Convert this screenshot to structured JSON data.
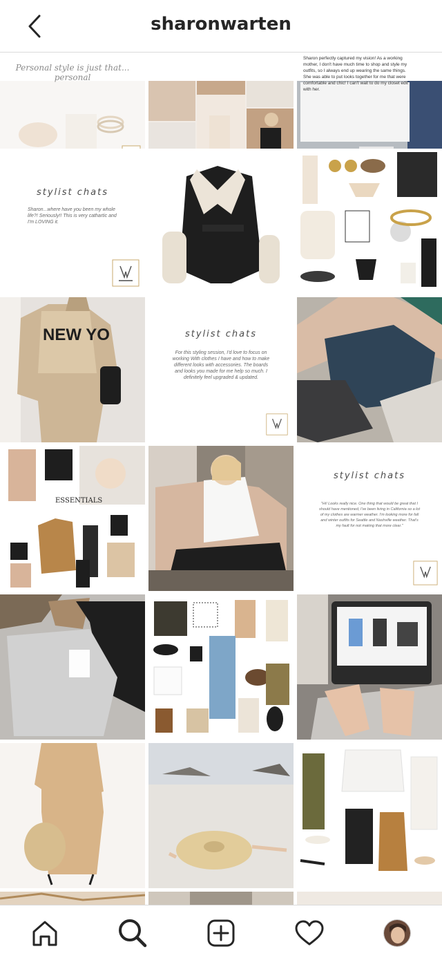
{
  "header": {
    "title": "sharonwarten",
    "back_icon": "chevron-left-icon"
  },
  "posts": [
    {
      "id": "post-1",
      "kind": "quote-image",
      "text": "Personal style is just that... personal"
    },
    {
      "id": "post-2",
      "kind": "photo-collage"
    },
    {
      "id": "post-3",
      "kind": "photo-text",
      "text": "Sharon perfectly captured my vision! As a working mother, I don't have much time to shop and style my outfits, so I always end up wearing the same things. She was able to put looks together for me that were comfortable and chic! I can't wait to do my closet edit with her."
    },
    {
      "id": "post-4",
      "kind": "quote",
      "title": "stylist chats",
      "text": "Sharon...where have you been my whole life?! Seriously!! This is very cathartic and I'm LOVING it."
    },
    {
      "id": "post-5",
      "kind": "photo"
    },
    {
      "id": "post-6",
      "kind": "photo"
    },
    {
      "id": "post-7",
      "kind": "photo",
      "text": "NEW YO"
    },
    {
      "id": "post-8",
      "kind": "quote",
      "title": "stylist chats",
      "text": "For this styling session, I'd love to focus on working With clothes I have and how to make different looks with accessories. The boards and looks you made for me help so much. I definitely feel upgraded & updated."
    },
    {
      "id": "post-9",
      "kind": "photo"
    },
    {
      "id": "post-10",
      "kind": "essentials-board",
      "text": "ESSENTIALS"
    },
    {
      "id": "post-11",
      "kind": "photo"
    },
    {
      "id": "post-12",
      "kind": "quote",
      "title": "stylist chats",
      "text": "\"Hi! Looks really nice. One thing that would be great that I should have mentioned, I've been living in California so a lot of my clothes are warmer weather. I'm looking more for fall and winter outfits for Seattle and Nashville weather. That's my fault for not making that more clear.\""
    },
    {
      "id": "post-13",
      "kind": "photo"
    },
    {
      "id": "post-14",
      "kind": "photo"
    },
    {
      "id": "post-15",
      "kind": "photo"
    },
    {
      "id": "post-16",
      "kind": "photo"
    },
    {
      "id": "post-17",
      "kind": "photo"
    },
    {
      "id": "post-18",
      "kind": "photo"
    }
  ],
  "nav": {
    "home_icon": "home-icon",
    "search_icon": "search-icon",
    "add_icon": "add-post-icon",
    "activity_icon": "heart-icon",
    "profile_icon": "profile-avatar"
  },
  "colors": {
    "text": "#262626",
    "divider": "#dbdbdb",
    "background": "#ffffff"
  }
}
